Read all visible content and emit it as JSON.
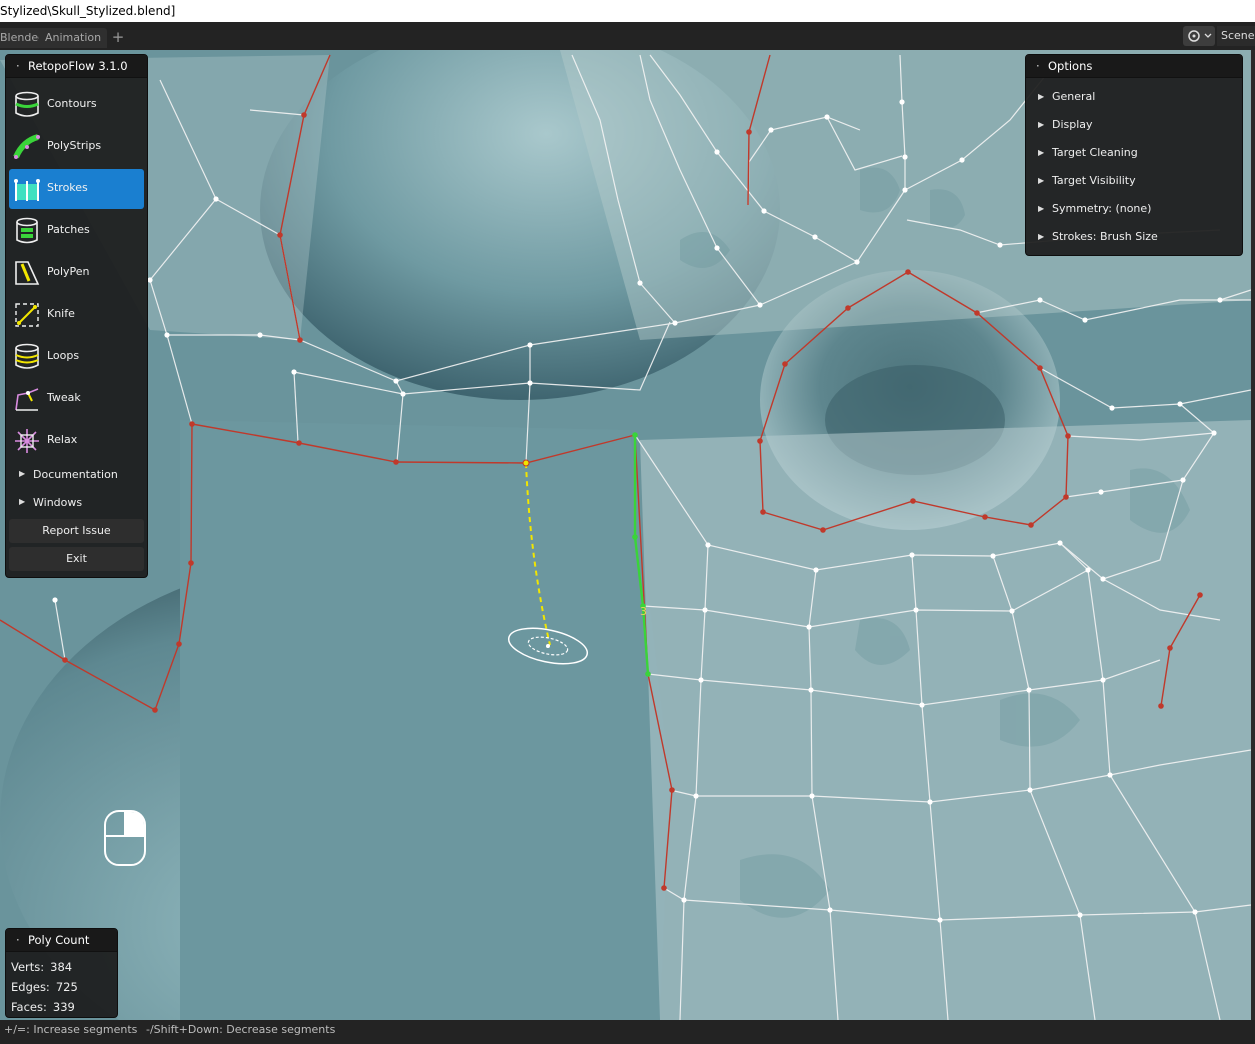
{
  "window": {
    "title": "Stylized\\Skull_Stylized.blend]"
  },
  "tabs": [
    "Blended",
    "Animation"
  ],
  "tab_add": "+",
  "scene": {
    "label": "Scene"
  },
  "tools_panel": {
    "title": "RetopoFlow 3.1.0",
    "tools": [
      {
        "label": "Contours",
        "icon": "contours-icon"
      },
      {
        "label": "PolyStrips",
        "icon": "polystrips-icon"
      },
      {
        "label": "Strokes",
        "icon": "strokes-icon",
        "active": true
      },
      {
        "label": "Patches",
        "icon": "patches-icon"
      },
      {
        "label": "PolyPen",
        "icon": "polypen-icon"
      },
      {
        "label": "Knife",
        "icon": "knife-icon"
      },
      {
        "label": "Loops",
        "icon": "loops-icon"
      },
      {
        "label": "Tweak",
        "icon": "tweak-icon"
      },
      {
        "label": "Relax",
        "icon": "relax-icon"
      }
    ],
    "documentation": "Documentation",
    "windows": "Windows",
    "report_issue": "Report Issue",
    "exit": "Exit"
  },
  "options_panel": {
    "title": "Options",
    "items": [
      "General",
      "Display",
      "Target Cleaning",
      "Target Visibility",
      "Symmetry: (none)",
      "Strokes: Brush Size"
    ]
  },
  "poly_count": {
    "title": "Poly Count",
    "verts_label": "Verts:",
    "verts": "384",
    "edges_label": "Edges:",
    "edges": "725",
    "faces_label": "Faces:",
    "faces": "339"
  },
  "viewport": {
    "segment_count": "3"
  },
  "statusbar": {
    "hint1": "+/=: Increase segments",
    "hint2": "-/Shift+Down: Decrease segments"
  },
  "colors": {
    "accent": "#1a7fd0",
    "boundary_edge": "#c0392b",
    "stroke_preview": "#f2e600",
    "selected_edge": "#3ad43a",
    "mesh_edge": "#ffffff"
  }
}
